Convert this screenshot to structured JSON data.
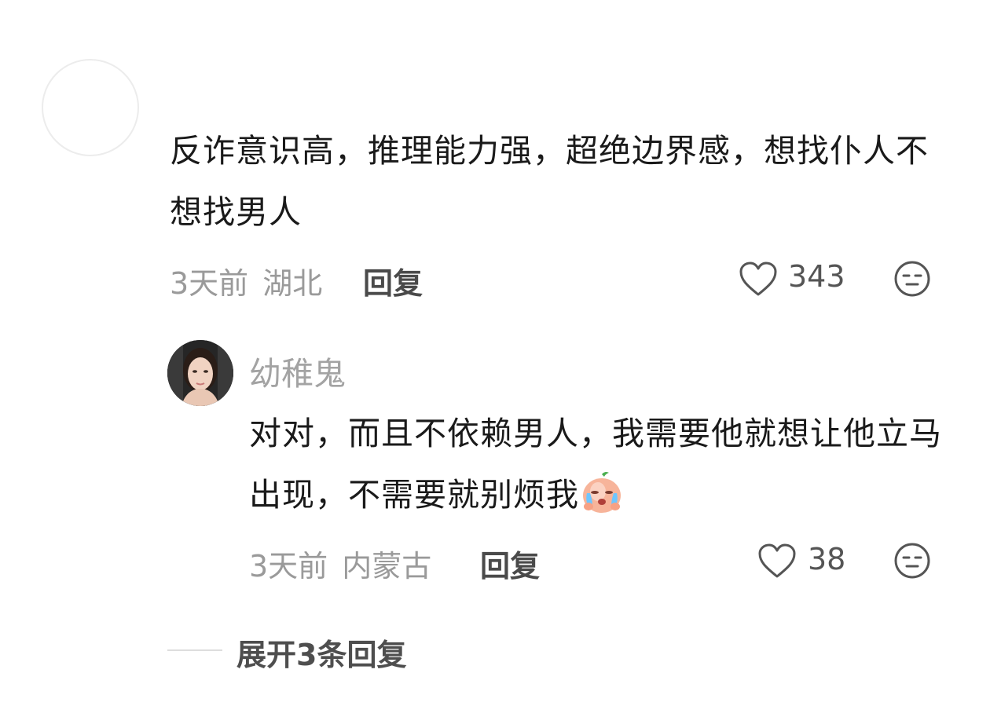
{
  "comment": {
    "text": "反诈意识高，推理能力强，超绝边界感，想找仆人不想找男人",
    "time": "3天前",
    "location": "湖北",
    "reply_label": "回复",
    "likes": "343"
  },
  "reply": {
    "username": "幼稚鬼",
    "text": "对对，而且不依赖男人，我需要他就想让他立马出现，不需要就别烦我",
    "emoji": "crying-peach-emoji",
    "time": "3天前",
    "location": "内蒙古",
    "reply_label": "回复",
    "likes": "38"
  },
  "expand": {
    "label": "展开3条回复"
  }
}
